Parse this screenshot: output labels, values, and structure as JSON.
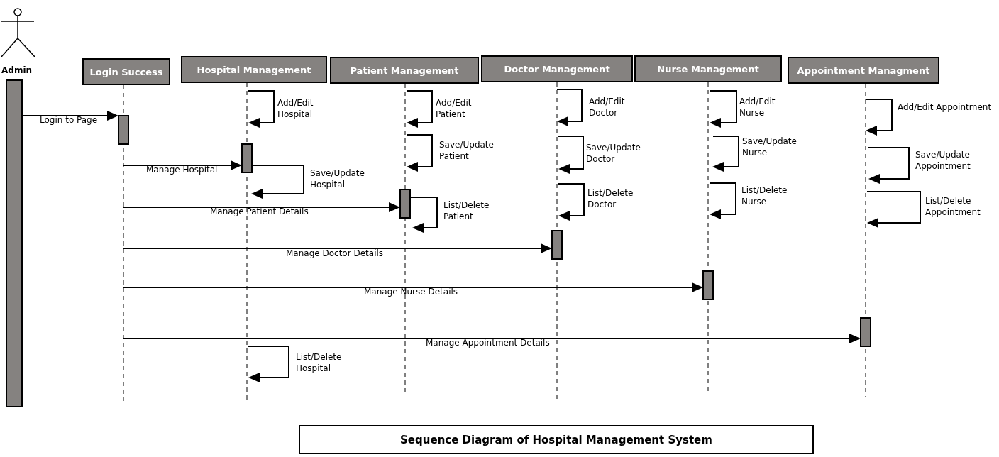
{
  "actor": {
    "name": "Admin"
  },
  "lifelines": [
    {
      "name": "Login Success",
      "incoming": "Login to Page"
    },
    {
      "name": "Hospital Management",
      "incoming": "Manage Hospital",
      "self_messages": [
        "Add/Edit Hospital",
        "Save/Update Hospital",
        "List/Delete Hospital"
      ]
    },
    {
      "name": "Patient Management",
      "incoming": "Manage Patient Details",
      "self_messages": [
        "Add/Edit Patient",
        "Save/Update Patient",
        "List/Delete Patient"
      ]
    },
    {
      "name": "Doctor Management",
      "incoming": "Manage Doctor Details",
      "self_messages": [
        "Add/Edit Doctor",
        "Save/Update Doctor",
        "List/Delete Doctor"
      ]
    },
    {
      "name": "Nurse Management",
      "incoming": "Manage Nurse Details",
      "self_messages": [
        "Add/Edit Nurse",
        "Save/Update Nurse",
        "List/Delete Nurse"
      ]
    },
    {
      "name": "Appointment Managment",
      "incoming": "Manage Appointment Details",
      "self_messages": [
        "Add/Edit Appointment",
        "Save/Update Appointment",
        "List/Delete Appointment"
      ]
    }
  ],
  "title": "Sequence Diagram of Hospital Management System"
}
